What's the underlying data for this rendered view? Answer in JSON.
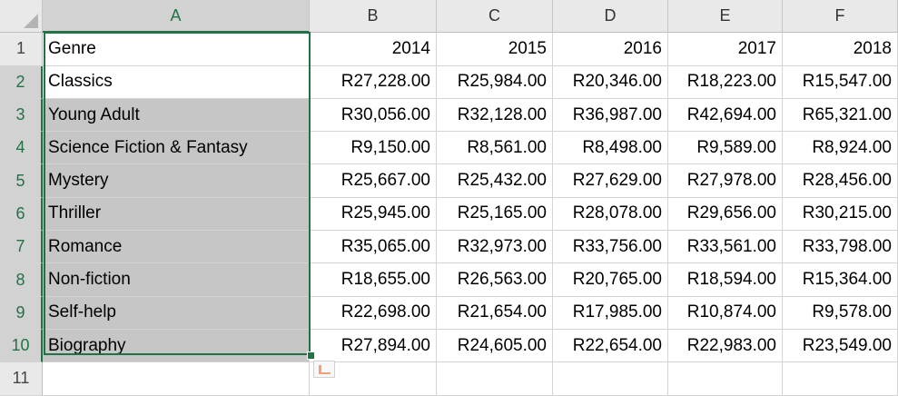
{
  "columns": [
    "A",
    "B",
    "C",
    "D",
    "E",
    "F"
  ],
  "rows": [
    {
      "num": "1",
      "cells": [
        "Genre",
        "2014",
        "2015",
        "2016",
        "2017",
        "2018"
      ]
    },
    {
      "num": "2",
      "cells": [
        "Classics",
        "R27,228.00",
        "R25,984.00",
        "R20,346.00",
        "R18,223.00",
        "R15,547.00"
      ]
    },
    {
      "num": "3",
      "cells": [
        "Young Adult",
        "R30,056.00",
        "R32,128.00",
        "R36,987.00",
        "R42,694.00",
        "R65,321.00"
      ]
    },
    {
      "num": "4",
      "cells": [
        "Science Fiction & Fantasy",
        "R9,150.00",
        "R8,561.00",
        "R8,498.00",
        "R9,589.00",
        "R8,924.00"
      ]
    },
    {
      "num": "5",
      "cells": [
        "Mystery",
        "R25,667.00",
        "R25,432.00",
        "R27,629.00",
        "R27,978.00",
        "R28,456.00"
      ]
    },
    {
      "num": "6",
      "cells": [
        "Thriller",
        "R25,945.00",
        "R25,165.00",
        "R28,078.00",
        "R29,656.00",
        "R30,215.00"
      ]
    },
    {
      "num": "7",
      "cells": [
        "Romance",
        "R35,065.00",
        "R32,973.00",
        "R33,756.00",
        "R33,561.00",
        "R33,798.00"
      ]
    },
    {
      "num": "8",
      "cells": [
        "Non-fiction",
        "R18,655.00",
        "R26,563.00",
        "R20,765.00",
        "R18,594.00",
        "R15,364.00"
      ]
    },
    {
      "num": "9",
      "cells": [
        "Self-help",
        "R22,698.00",
        "R21,654.00",
        "R17,985.00",
        "R10,874.00",
        "R9,578.00"
      ]
    },
    {
      "num": "10",
      "cells": [
        "Biography",
        "R27,894.00",
        "R24,605.00",
        "R22,654.00",
        "R22,983.00",
        "R23,549.00"
      ]
    },
    {
      "num": "11",
      "cells": [
        "",
        "",
        "",
        "",
        "",
        ""
      ]
    }
  ],
  "selection": {
    "column": "A",
    "range": "A2:A10"
  },
  "colors": {
    "accent": "#217346",
    "selected_fill": "#c6c6c6",
    "header_fill": "#e9e9e9"
  },
  "icons": {
    "corner": "select-all-triangle-icon",
    "quick_analysis": "quick-analysis-icon"
  }
}
